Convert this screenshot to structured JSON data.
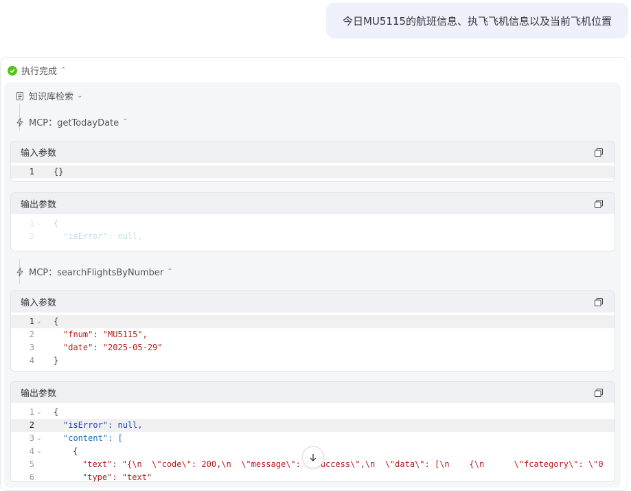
{
  "user_message": "今日MU5115的航班信息、执飞飞机信息以及当前飞机位置",
  "status": {
    "label": "执行完成"
  },
  "steps": {
    "kb": {
      "label": "知识库检索"
    },
    "mcp1": {
      "label": "MCP：getTodayDate",
      "input_title": "输入参数",
      "output_title": "输出参数",
      "input_code": [
        "{}"
      ],
      "output_code": [
        "{",
        "\"isError\": null,"
      ]
    },
    "mcp2": {
      "label": "MCP：searchFlightsByNumber",
      "input_title": "输入参数",
      "output_title": "输出参数",
      "input_code": [
        "{",
        "\"fnum\": \"MU5115\",",
        "\"date\": \"2025-05-29\"",
        "}"
      ],
      "output_code": [
        "{",
        "\"isError\": null,",
        "\"content\": [",
        "{",
        "\"text\": \"{\\n  \\\"code\\\": 200,\\n  \\\"message\\\": \\\"Success\\\",\\n  \\\"data\\\": [\\n    {\\n      \\\"fcategory\\\": \\\"0",
        "\"type\": \"text\""
      ]
    }
  },
  "line_numbers": [
    "1",
    "2",
    "3",
    "4",
    "5",
    "6"
  ]
}
